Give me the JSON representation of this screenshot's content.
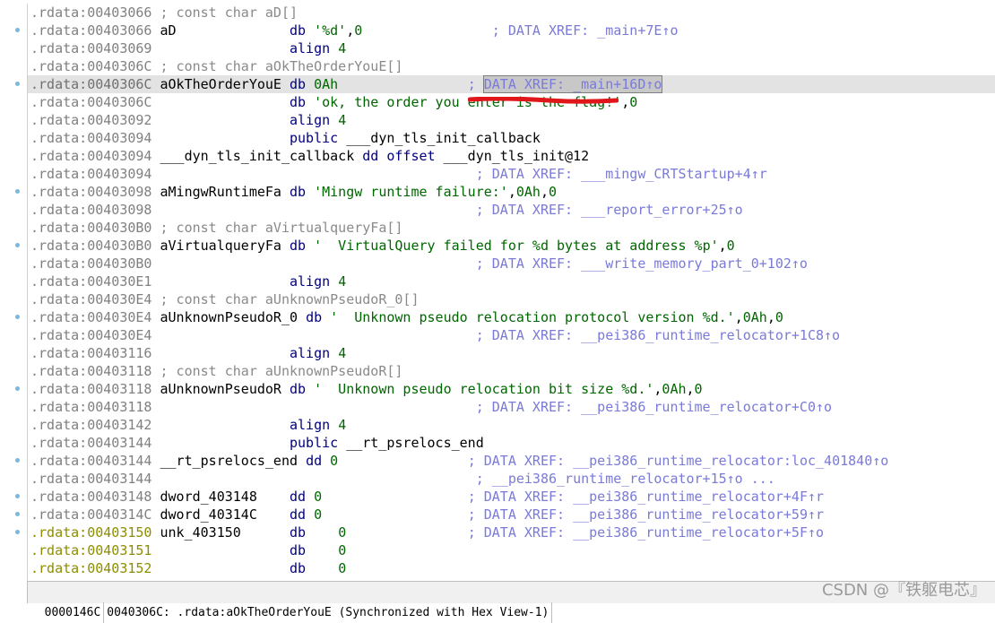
{
  "listing": {
    "lines": [
      {
        "addr": ".rdata:00403066",
        "rest": " ; const char aD[]"
      },
      {
        "addr": ".rdata:00403066",
        "rest": " aD              db '%d',0                ; DATA XREF: _main+7E↑o"
      },
      {
        "addr": ".rdata:00403069",
        "rest": "                 align 4"
      },
      {
        "addr": ".rdata:0040306C",
        "rest": " ; const char aOkTheOrderYouE[]"
      },
      {
        "addr": ".rdata:0040306C",
        "rest": " aOkTheOrderYouE db 0Ah                ; DATA XREF: _main+16D↑o"
      },
      {
        "addr": ".rdata:0040306C",
        "rest": "                 db 'ok, the order you enter is the flag!',0"
      },
      {
        "addr": ".rdata:00403092",
        "rest": "                 align 4"
      },
      {
        "addr": ".rdata:00403094",
        "rest": "                 public ___dyn_tls_init_callback"
      },
      {
        "addr": ".rdata:00403094",
        "rest": " ___dyn_tls_init_callback dd offset ___dyn_tls_init@12"
      },
      {
        "addr": ".rdata:00403094",
        "rest": "                                        ; DATA XREF: ___mingw_CRTStartup+4↑r"
      },
      {
        "addr": ".rdata:00403098",
        "rest": " aMingwRuntimeFa db 'Mingw runtime failure:',0Ah,0"
      },
      {
        "addr": ".rdata:00403098",
        "rest": "                                        ; DATA XREF: ___report_error+25↑o"
      },
      {
        "addr": ".rdata:004030B0",
        "rest": " ; const char aVirtualqueryFa[]"
      },
      {
        "addr": ".rdata:004030B0",
        "rest": " aVirtualqueryFa db '  VirtualQuery failed for %d bytes at address %p',0"
      },
      {
        "addr": ".rdata:004030B0",
        "rest": "                                        ; DATA XREF: ___write_memory_part_0+102↑o"
      },
      {
        "addr": ".rdata:004030E1",
        "rest": "                 align 4"
      },
      {
        "addr": ".rdata:004030E4",
        "rest": " ; const char aUnknownPseudoR_0[]"
      },
      {
        "addr": ".rdata:004030E4",
        "rest": " aUnknownPseudoR_0 db '  Unknown pseudo relocation protocol version %d.',0Ah,0"
      },
      {
        "addr": ".rdata:004030E4",
        "rest": "                                        ; DATA XREF: __pei386_runtime_relocator+1C8↑o"
      },
      {
        "addr": ".rdata:00403116",
        "rest": "                 align 4"
      },
      {
        "addr": ".rdata:00403118",
        "rest": " ; const char aUnknownPseudoR[]"
      },
      {
        "addr": ".rdata:00403118",
        "rest": " aUnknownPseudoR db '  Unknown pseudo relocation bit size %d.',0Ah,0"
      },
      {
        "addr": ".rdata:00403118",
        "rest": "                                        ; DATA XREF: __pei386_runtime_relocator+C0↑o"
      },
      {
        "addr": ".rdata:00403142",
        "rest": "                 align 4"
      },
      {
        "addr": ".rdata:00403144",
        "rest": "                 public __rt_psrelocs_end"
      },
      {
        "addr": ".rdata:00403144",
        "rest": " __rt_psrelocs_end dd 0                ; DATA XREF: __pei386_runtime_relocator:loc_401840↑o"
      },
      {
        "addr": ".rdata:00403144",
        "rest": "                                        ; __pei386_runtime_relocator+15↑o ..."
      },
      {
        "addr": ".rdata:00403148",
        "rest": " dword_403148    dd 0                  ; DATA XREF: __pei386_runtime_relocator+4F↑r"
      },
      {
        "addr": ".rdata:0040314C",
        "rest": " dword_40314C    dd 0                  ; DATA XREF: __pei386_runtime_relocator+59↑r"
      },
      {
        "addr": ".rdata:00403150",
        "rest": " unk_403150      db    0               ; DATA XREF: __pei386_runtime_relocator+5F↑o"
      },
      {
        "addr": ".rdata:00403151",
        "rest": "                 db    0"
      },
      {
        "addr": ".rdata:00403152",
        "rest": "                 db    0"
      }
    ]
  },
  "status": {
    "offset": "0000146C",
    "location": "0040306C: .rdata:aOkTheOrderYouE",
    "sync": "(Synchronized with Hex View-1)"
  },
  "watermark": "CSDN @『铁躯电芯』",
  "colors": {
    "address": "#808080",
    "address_unexplored": "#8d8d00",
    "string": "#006600",
    "xref": "#7a7ad8",
    "name": "#000080",
    "selection": "#e3e3e3",
    "red_scribble": "#e0161a"
  }
}
